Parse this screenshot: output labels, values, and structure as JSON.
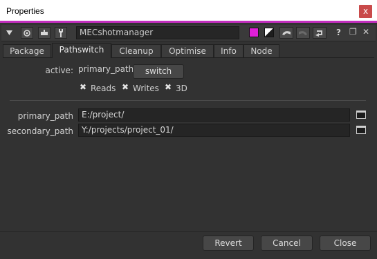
{
  "window": {
    "title": "Properties",
    "close_glyph": "x"
  },
  "toolbar": {
    "node_name": "MECshotmanager",
    "help_glyph": "?",
    "float_glyph": "❐",
    "close_glyph": "✕",
    "colors": {
      "node_color": "#e020d8"
    }
  },
  "tabs": [
    "Package",
    "Pathswitch",
    "Cleanup",
    "Optimise",
    "Info",
    "Node"
  ],
  "active_tab": "Pathswitch",
  "pathswitch": {
    "active_label": "active:",
    "active_value": "primary_path",
    "switch_button": "switch",
    "checkboxes": [
      {
        "label": "Reads",
        "checked": true
      },
      {
        "label": "Writes",
        "checked": true
      },
      {
        "label": "3D",
        "checked": true
      }
    ],
    "primary_label": "primary_path",
    "primary_value": "E:/project/",
    "secondary_label": "secondary_path",
    "secondary_value": "Y:/projects/project_01/"
  },
  "footer": {
    "revert": "Revert",
    "cancel": "Cancel",
    "close": "Close"
  }
}
